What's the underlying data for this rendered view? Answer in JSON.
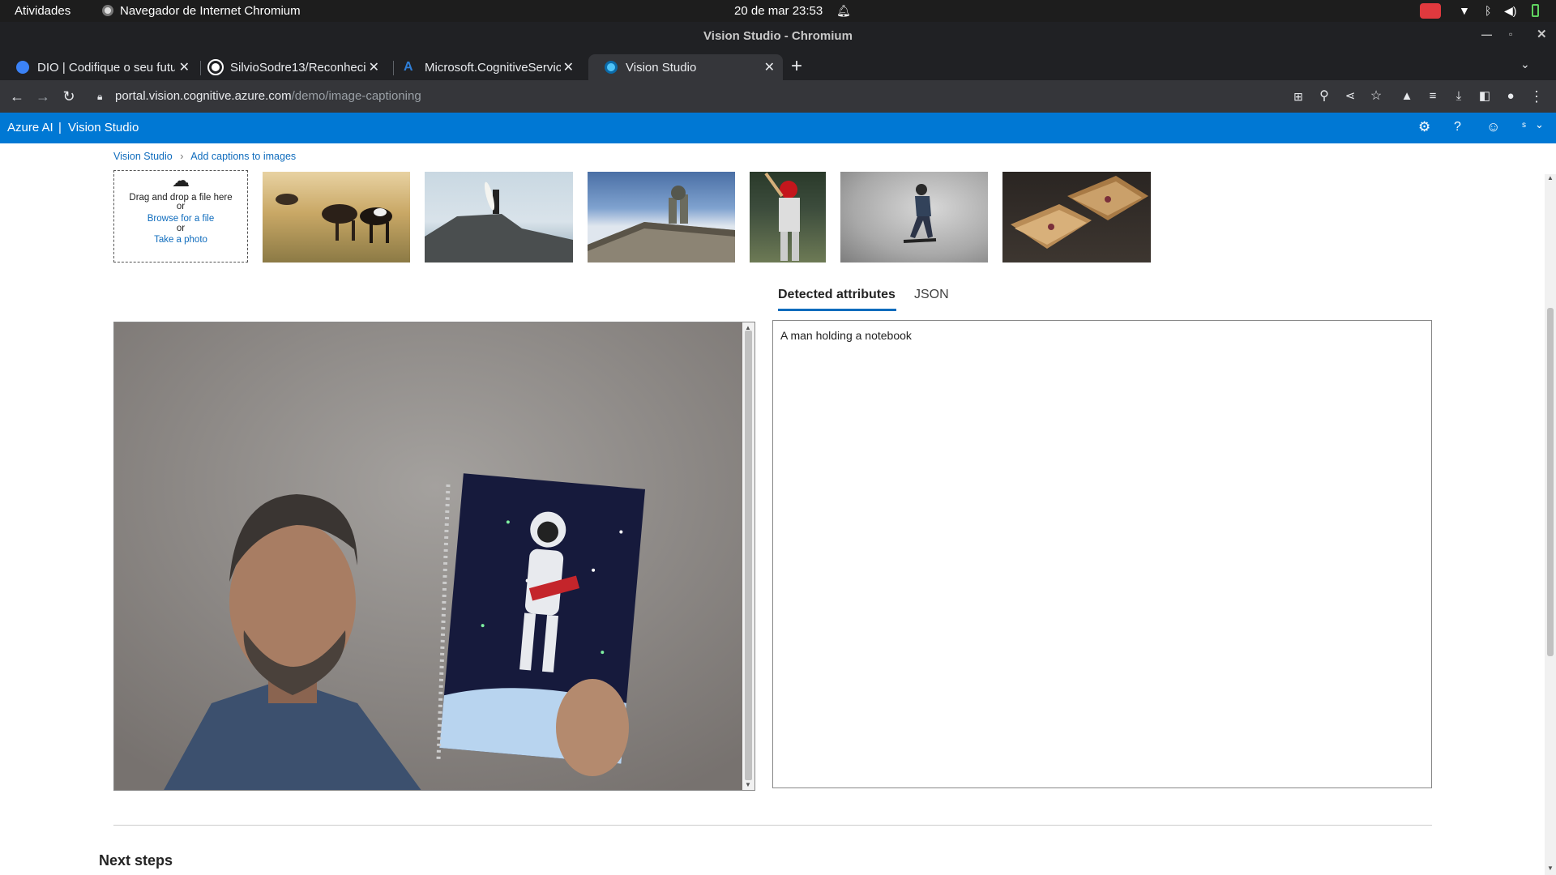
{
  "os_bar": {
    "activities": "Atividades",
    "app_name": "Navegador de Internet Chromium",
    "datetime": "20 de mar  23:53"
  },
  "window": {
    "title": "Vision Studio - Chromium"
  },
  "tabs": [
    {
      "label": "DIO | Codifique o seu futuro",
      "favicon_color": "#3b82f6"
    },
    {
      "label": "SilvioSodre13/Reconhecimento",
      "favicon_color": "#ffffff"
    },
    {
      "label": "Microsoft.CognitiveServices",
      "favicon_color": "#2f7fd8"
    },
    {
      "label": "Vision Studio",
      "favicon_color": "#4fc3f7"
    }
  ],
  "address": {
    "host": "portal.vision.cognitive.azure.com",
    "path": "/demo/image-captioning"
  },
  "azure_header": {
    "brand": "Azure AI",
    "separator": "|",
    "product": "Vision Studio",
    "user_initial": "s"
  },
  "breadcrumb": {
    "root": "Vision Studio",
    "current": "Add captions to images"
  },
  "dropzone": {
    "line1": "Drag and drop a file here",
    "or1": "or",
    "browse": "Browse for a file",
    "or2": "or",
    "take_photo": "Take a photo"
  },
  "sample_images": [
    {
      "name": "cows-in-field"
    },
    {
      "name": "surfer-on-cliff"
    },
    {
      "name": "building-statues"
    },
    {
      "name": "baseball-batter"
    },
    {
      "name": "skateboarder"
    },
    {
      "name": "grilled-sandwich"
    }
  ],
  "result_tabs": {
    "detected": "Detected attributes",
    "json": "JSON"
  },
  "caption": "A man holding a notebook",
  "next_steps": "Next steps",
  "colors": {
    "azure_blue": "#0078d4",
    "link_blue": "#0f6cbd"
  }
}
